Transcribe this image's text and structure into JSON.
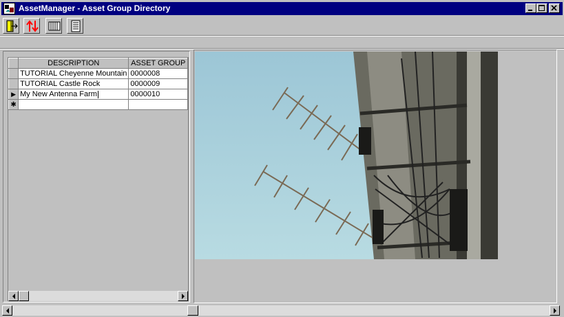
{
  "window": {
    "title": "AssetManager - Asset Group Directory"
  },
  "caption_buttons": [
    "minimize-icon",
    "maximize-icon",
    "close-icon"
  ],
  "toolbar": {
    "buttons": [
      {
        "name": "exit-door-icon"
      },
      {
        "name": "sort-updown-icon"
      },
      {
        "name": "columns-icon"
      },
      {
        "name": "list-view-icon"
      }
    ]
  },
  "grid": {
    "columns": [
      "DESCRIPTION",
      "ASSET GROUP"
    ],
    "rows": [
      {
        "description": "TUTORIAL Cheyenne Mountain",
        "asset_group": "0000008"
      },
      {
        "description": "TUTORIAL Castle Rock",
        "asset_group": "0000009"
      },
      {
        "description": "My New Antenna Farm",
        "asset_group": "0000010"
      }
    ],
    "current_row_marker": "▶",
    "new_row_marker": "✱"
  },
  "colors": {
    "titlebar": "#000080",
    "face": "#c0c0c0",
    "sky": "#a9cdd8"
  }
}
